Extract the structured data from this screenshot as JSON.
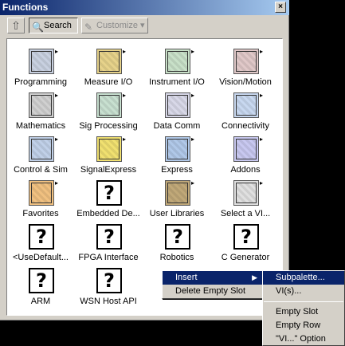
{
  "window": {
    "title": "Functions",
    "close_icon": "×"
  },
  "toolbar": {
    "up_icon": "⇧",
    "search_label": "Search",
    "search_icon": "🔍",
    "customize_label": "Customize ▾",
    "customize_icon": "✎"
  },
  "palette": {
    "items": [
      {
        "label": "Programming"
      },
      {
        "label": "Measure I/O"
      },
      {
        "label": "Instrument I/O"
      },
      {
        "label": "Vision/Motion"
      },
      {
        "label": "Mathematics"
      },
      {
        "label": "Sig Processing"
      },
      {
        "label": "Data Comm"
      },
      {
        "label": "Connectivity"
      },
      {
        "label": "Control & Sim"
      },
      {
        "label": "SignalExpress"
      },
      {
        "label": "Express"
      },
      {
        "label": "Addons"
      },
      {
        "label": "Favorites"
      },
      {
        "label": "Embedded De..."
      },
      {
        "label": "User Libraries"
      },
      {
        "label": "Select a VI..."
      },
      {
        "label": "<UseDefault..."
      },
      {
        "label": "FPGA Interface"
      },
      {
        "label": "Robotics"
      },
      {
        "label": "C Generator"
      },
      {
        "label": "ARM"
      },
      {
        "label": "WSN Host API"
      }
    ],
    "missing_glyph": "?",
    "submenu_marker": "▸"
  },
  "context_menu": {
    "items": [
      {
        "label": "Insert",
        "submenu_arrow": "▶"
      },
      {
        "label": "Delete Empty Slot"
      }
    ]
  },
  "submenu": {
    "items": [
      {
        "label": "Subpalette..."
      },
      {
        "label": "VI(s)..."
      },
      {
        "label": "Empty Slot"
      },
      {
        "label": "Empty Row"
      },
      {
        "label": "\"VI...\" Option"
      }
    ]
  },
  "colors": {
    "selection": "#0a246a",
    "face": "#d4d0c8",
    "title_start": "#0a246a",
    "title_end": "#a6caf0"
  }
}
